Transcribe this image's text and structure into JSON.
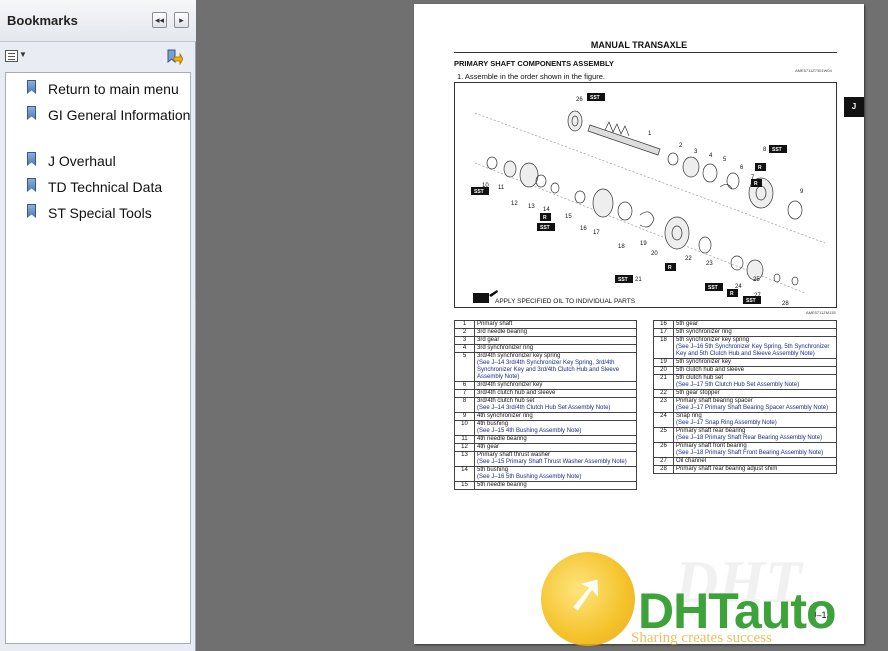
{
  "panel": {
    "title": "Bookmarks",
    "collapse_btn": "◂◂",
    "expand_btn": "▸",
    "items": [
      {
        "label": "Return to main menu"
      },
      {
        "label": "GI General Information"
      },
      {
        "label": "J Overhaul"
      },
      {
        "label": "TD Technical Data"
      },
      {
        "label": "ST Special Tools"
      }
    ]
  },
  "document": {
    "header": "MANUAL TRANSAXLE",
    "section_title": "PRIMARY SHAFT COMPONENTS ASSEMBLY",
    "doc_code": "AME5711Z7301W04",
    "instruction": "1.  Assemble in the order shown in the figure.",
    "tab_letter": "J",
    "figure_caption": "APPLY SPECIFIED OIL TO INDIVIDUAL PARTS",
    "figure_code": "AME5711ZM135",
    "page_number": "J–13",
    "sst_label": "SST",
    "r_label": "R",
    "callouts": [
      "1",
      "2",
      "3",
      "4",
      "5",
      "6",
      "7",
      "8",
      "9",
      "10",
      "11",
      "12",
      "13",
      "14",
      "15",
      "16",
      "17",
      "18",
      "19",
      "20",
      "21",
      "22",
      "23",
      "24",
      "25",
      "26",
      "27",
      "28"
    ],
    "parts_left": [
      {
        "n": "1",
        "name": "Primary shaft",
        "note": ""
      },
      {
        "n": "2",
        "name": "3rd needle bearing",
        "note": ""
      },
      {
        "n": "3",
        "name": "3rd gear",
        "note": ""
      },
      {
        "n": "4",
        "name": "3rd synchronizer ring",
        "note": ""
      },
      {
        "n": "5",
        "name": "3rd/4th synchronizer key spring",
        "note": "(See J–14 3rd/4th Synchronizer Key Spring, 3rd/4th Synchronizer Key and 3rd/4th Clutch Hub and Sleeve Assembly Note)"
      },
      {
        "n": "6",
        "name": "3rd/4th synchronizer key",
        "note": ""
      },
      {
        "n": "7",
        "name": "3rd/4th clutch hub and sleeve",
        "note": ""
      },
      {
        "n": "8",
        "name": "3rd/4th clutch hub set",
        "note": "(See J–14 3rd/4th Clutch Hub Set Assembly Note)"
      },
      {
        "n": "9",
        "name": "4th synchronizer ring",
        "note": ""
      },
      {
        "n": "10",
        "name": "4th bushing",
        "note": "(See J–15 4th Bushing Assembly Note)"
      },
      {
        "n": "11",
        "name": "4th needle bearing",
        "note": ""
      },
      {
        "n": "12",
        "name": "4th gear",
        "note": ""
      },
      {
        "n": "13",
        "name": "Primary shaft thrust washer",
        "note": "(See J–15 Primary Shaft Thrust Washer Assembly Note)"
      },
      {
        "n": "14",
        "name": "5th bushing",
        "note": "(See J–16 5th Bushing Assembly Note)"
      },
      {
        "n": "15",
        "name": "5th needle bearing",
        "note": ""
      }
    ],
    "parts_right": [
      {
        "n": "16",
        "name": "5th gear",
        "note": ""
      },
      {
        "n": "17",
        "name": "5th synchronizer ring",
        "note": ""
      },
      {
        "n": "18",
        "name": "5th synchronizer key spring",
        "note": "(See J–16 5th Synchronizer Key Spring, 5th Synchronizer Key and 5th Clutch Hub and Sleeve Assembly Note)"
      },
      {
        "n": "19",
        "name": "5th synchronizer key",
        "note": ""
      },
      {
        "n": "20",
        "name": "5th clutch hub and sleeve",
        "note": ""
      },
      {
        "n": "21",
        "name": "5th clutch hub set",
        "note": "(See J–17 5th Clutch Hub Set Assembly Note)"
      },
      {
        "n": "22",
        "name": "5th gear stopper",
        "note": ""
      },
      {
        "n": "23",
        "name": "Primary shaft bearing spacer",
        "note": "(See J–17 Primary Shaft Bearing Spacer Assembly Note)"
      },
      {
        "n": "24",
        "name": "Snap ring",
        "note": "(See J–17 Snap Ring Assembly Note)"
      },
      {
        "n": "25",
        "name": "Primary shaft rear bearing",
        "note": "(See J–18 Primary Shaft Rear Bearing Assembly Note)"
      },
      {
        "n": "26",
        "name": "Primary shaft front bearing",
        "note": "(See J–18 Primary Shaft Front Bearing Assembly Note)"
      },
      {
        "n": "27",
        "name": "Oil channel",
        "note": ""
      },
      {
        "n": "28",
        "name": "Primary shaft rear bearing adjust shim",
        "note": ""
      }
    ]
  },
  "watermark": {
    "brand": "DHTauto",
    "slogan": "Sharing creates success",
    "ghost": "DHT"
  },
  "colors": {
    "panel_bg": "#e9ecf2",
    "doc_bg": "#707070",
    "link_note": "#1a2a8a",
    "brand_green": "#3ea23b",
    "brand_yellow": "#f2b705"
  }
}
